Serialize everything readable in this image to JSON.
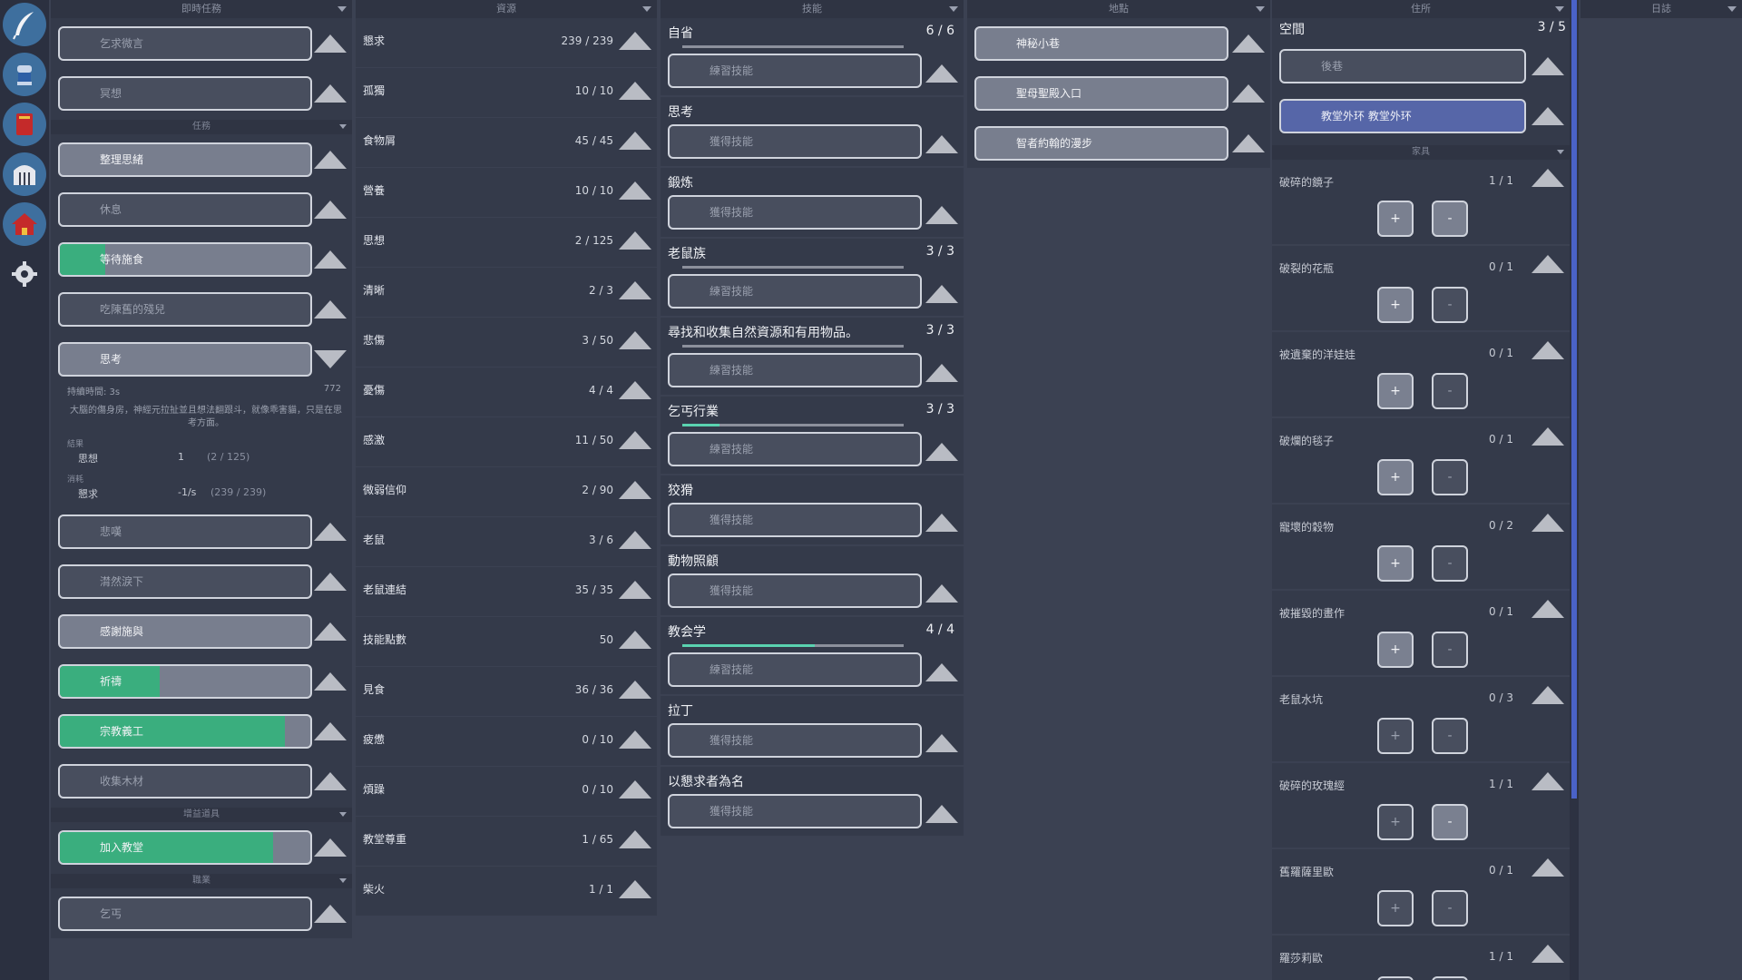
{
  "colors": {
    "accent_green": "#3aae7e",
    "accent_blue": "#5666a8",
    "bar_teal": "#5ad2b0"
  },
  "sidebar": {
    "icons": [
      "quill-icon",
      "knight-icon",
      "book-icon",
      "jail-icon",
      "house-icon",
      "gear-icon"
    ]
  },
  "headers": {
    "tasks": "即時任務",
    "resources": "資源",
    "skills": "技能",
    "locations": "地點",
    "home": "住所",
    "log": "日誌"
  },
  "tasks": {
    "sub_tasks": "任務",
    "sub_upgrades": "增益道具",
    "sub_jobs": "職業",
    "immediate": [
      {
        "label": "乞求微言",
        "lit": false,
        "progress": 0
      },
      {
        "label": "冥想",
        "lit": false,
        "progress": 0
      }
    ],
    "list": [
      {
        "label": "整理思緒",
        "lit": true,
        "progress": 0
      },
      {
        "label": "休息",
        "lit": false,
        "progress": 0
      },
      {
        "label": "等待施食",
        "lit": true,
        "progress": 0.18
      },
      {
        "label": "吃陳舊的殘兒",
        "lit": false,
        "progress": 0
      }
    ],
    "open": {
      "label": "思考",
      "duration": "持續時間: 3s",
      "duration_value": "772",
      "desc": "大腦的傷身房，神經元拉扯並且想法翻跟斗，就像乖害貓，只是在思考方面。",
      "result_title": "結果",
      "result": {
        "name": "思想",
        "value": "1",
        "extra": "(2 / 125)"
      },
      "cost_title": "消耗",
      "cost": {
        "name": "懇求",
        "value": "-1/s",
        "extra": "(239 / 239)"
      }
    },
    "list2": [
      {
        "label": "悲嘆",
        "lit": false,
        "progress": 0
      },
      {
        "label": "潸然淚下",
        "lit": false,
        "progress": 0
      },
      {
        "label": "感謝施與",
        "lit": true,
        "progress": 0
      },
      {
        "label": "祈禱",
        "lit": true,
        "progress": 0.4
      },
      {
        "label": "宗教義工",
        "lit": true,
        "progress": 0.9
      },
      {
        "label": "收集木材",
        "lit": false,
        "progress": 0
      }
    ],
    "upgrades": [
      {
        "label": "加入教堂",
        "lit": true,
        "progress": 0.85
      }
    ],
    "jobs": [
      {
        "label": "乞丐",
        "lit": false,
        "progress": 0
      }
    ]
  },
  "resources": [
    {
      "name": "懇求",
      "value": "239 / 239"
    },
    {
      "name": "孤獨",
      "value": "10 / 10"
    },
    {
      "name": "食物屑",
      "value": "45 / 45"
    },
    {
      "name": "營養",
      "value": "10 / 10"
    },
    {
      "name": "思想",
      "value": "2 / 125"
    },
    {
      "name": "清晰",
      "value": "2 / 3"
    },
    {
      "name": "悲傷",
      "value": "3 / 50"
    },
    {
      "name": "憂傷",
      "value": "4 / 4"
    },
    {
      "name": "感激",
      "value": "11 / 50"
    },
    {
      "name": "微弱信仰",
      "value": "2 / 90"
    },
    {
      "name": "老鼠",
      "value": "3 / 6"
    },
    {
      "name": "老鼠連結",
      "value": "35 / 35"
    },
    {
      "name": "技能點數",
      "value": "50"
    },
    {
      "name": "見食",
      "value": "36 / 36"
    },
    {
      "name": "疲憊",
      "value": "0 / 10"
    },
    {
      "name": "煩躁",
      "value": "0 / 10"
    },
    {
      "name": "教堂尊重",
      "value": "1 / 65"
    },
    {
      "name": "柴火",
      "value": "1 / 1"
    }
  ],
  "skills": [
    {
      "name": "自省",
      "level": "6 / 6",
      "bar": true,
      "progress": 0,
      "button": "練習技能"
    },
    {
      "name": "思考",
      "level": "",
      "bar": false,
      "progress": 0,
      "button": "獲得技能"
    },
    {
      "name": "鍛炼",
      "level": "",
      "bar": false,
      "progress": 0,
      "button": "獲得技能"
    },
    {
      "name": "老鼠族",
      "level": "3 / 3",
      "bar": true,
      "progress": 0,
      "button": "練習技能"
    },
    {
      "name": "尋找和收集自然資源和有用物品。",
      "level": "3 / 3",
      "bar": true,
      "progress": 0,
      "button": "練習技能"
    },
    {
      "name": "乞丐行業",
      "level": "3 / 3",
      "bar": true,
      "progress": 0.17,
      "button": "練習技能"
    },
    {
      "name": "狡猾",
      "level": "",
      "bar": false,
      "progress": 0,
      "button": "獲得技能"
    },
    {
      "name": "動物照顧",
      "level": "",
      "bar": false,
      "progress": 0,
      "button": "獲得技能"
    },
    {
      "name": "教会学",
      "level": "4 / 4",
      "bar": true,
      "progress": 0.6,
      "button": "練習技能"
    },
    {
      "name": "拉丁",
      "level": "",
      "bar": false,
      "progress": 0,
      "button": "獲得技能"
    },
    {
      "name": "以懇求者為名",
      "level": "",
      "bar": false,
      "progress": 0,
      "button": "獲得技能"
    }
  ],
  "locations": [
    "神秘小巷",
    "聖母聖殿入口",
    "智者約翰的漫步"
  ],
  "home": {
    "space_label": "空間",
    "space_value": "3 / 5",
    "homes": [
      {
        "label": "後巷",
        "selected": false
      },
      {
        "label": "教堂外环 教堂外环",
        "selected": true
      }
    ],
    "furniture_header": "家具",
    "plus": "+",
    "minus": "-",
    "furniture": [
      {
        "name": "破碎的鏡子",
        "value": "1 / 1",
        "plus_lit": true,
        "minus_lit": true
      },
      {
        "name": "破裂的花瓶",
        "value": "0 / 1",
        "plus_lit": true,
        "minus_lit": false
      },
      {
        "name": "被遺棄的洋娃娃",
        "value": "0 / 1",
        "plus_lit": true,
        "minus_lit": false
      },
      {
        "name": "破爛的毯子",
        "value": "0 / 1",
        "plus_lit": true,
        "minus_lit": false
      },
      {
        "name": "寵壞的穀物",
        "value": "0 / 2",
        "plus_lit": true,
        "minus_lit": false
      },
      {
        "name": "被摧毀的畫作",
        "value": "0 / 1",
        "plus_lit": true,
        "minus_lit": false
      },
      {
        "name": "老鼠水坑",
        "value": "0 / 3",
        "plus_lit": false,
        "minus_lit": false
      },
      {
        "name": "破碎的玫瑰經",
        "value": "1 / 1",
        "plus_lit": false,
        "minus_lit": true
      },
      {
        "name": "舊羅薩里歐",
        "value": "0 / 1",
        "plus_lit": false,
        "minus_lit": false
      },
      {
        "name": "羅莎莉歐",
        "value": "1 / 1",
        "plus_lit": false,
        "minus_lit": false
      }
    ]
  }
}
